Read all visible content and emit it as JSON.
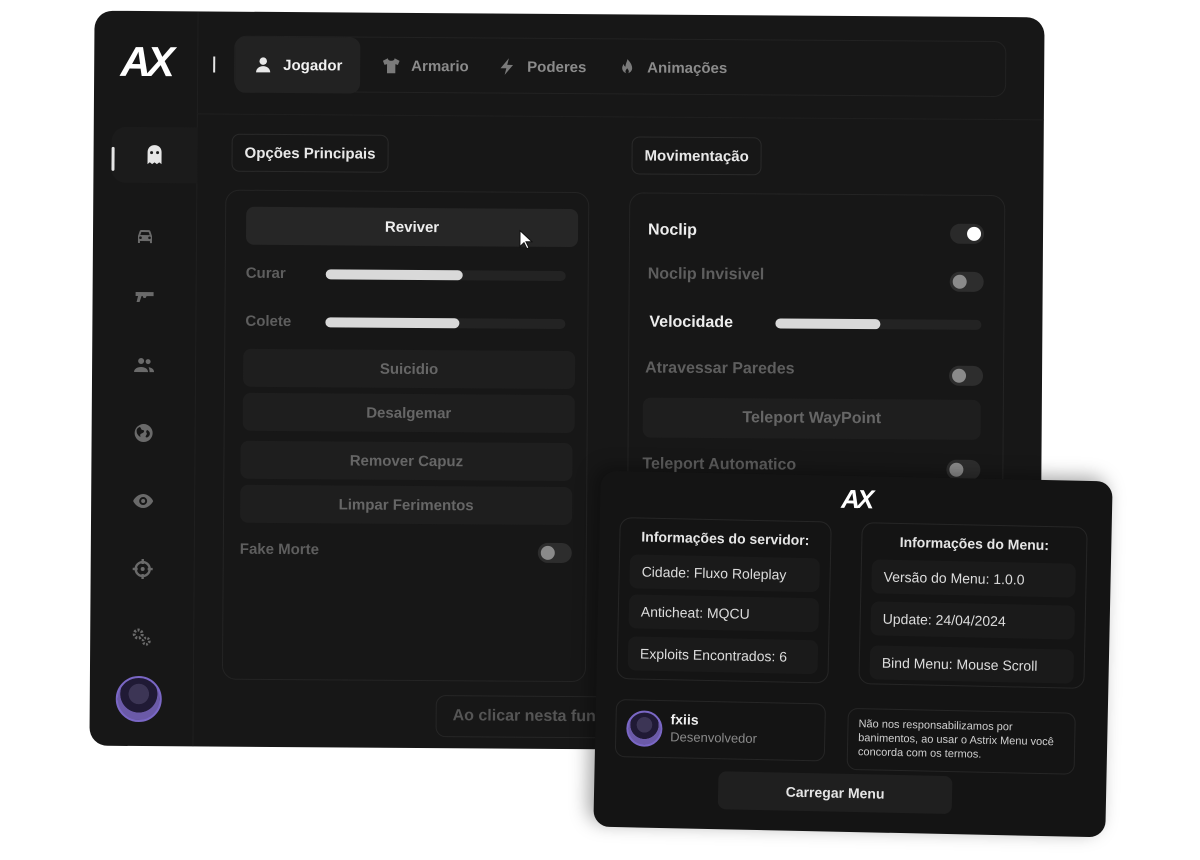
{
  "app": {
    "logo": "AX"
  },
  "tabs": [
    {
      "label": "Jogador",
      "icon": "user-icon",
      "active": true
    },
    {
      "label": "Armario",
      "icon": "shirt-icon"
    },
    {
      "label": "Poderes",
      "icon": "lightning-icon"
    },
    {
      "label": "Animações",
      "icon": "fire-icon"
    }
  ],
  "sidebar": {
    "items": [
      {
        "icon": "ghost-icon",
        "active": true
      },
      {
        "icon": "car-icon"
      },
      {
        "icon": "gun-icon"
      },
      {
        "icon": "users-icon"
      },
      {
        "icon": "globe-icon"
      },
      {
        "icon": "eye-icon"
      },
      {
        "icon": "crosshair-icon"
      },
      {
        "icon": "gears-icon"
      }
    ]
  },
  "main_options": {
    "title": "Opções Principais",
    "revive_label": "Reviver",
    "curar_label": "Curar",
    "curar_value": 0.57,
    "colete_label": "Colete",
    "colete_value": 0.56,
    "suicidio_label": "Suicidio",
    "desalgemar_label": "Desalgemar",
    "remover_capuz_label": "Remover Capuz",
    "limpar_label": "Limpar Ferimentos",
    "fake_morte_label": "Fake Morte",
    "fake_morte_on": false
  },
  "movement": {
    "title": "Movimentação",
    "noclip_label": "Noclip",
    "noclip_on": true,
    "noclip_invisivel_label": "Noclip Invisivel",
    "noclip_invisivel_on": false,
    "velocidade_label": "Velocidade",
    "velocidade_value": 0.51,
    "atravessar_label": "Atravessar Paredes",
    "atravessar_on": false,
    "teleport_waypoint_label": "Teleport WayPoint",
    "teleport_auto_label": "Teleport Automatico",
    "teleport_auto_on": false
  },
  "hint": "Ao clicar nesta fun",
  "info_card": {
    "logo": "AX",
    "server": {
      "title": "Informações do servidor:",
      "rows": [
        "Cidade: Fluxo Roleplay",
        "Anticheat: MQCU",
        "Exploits Encontrados: 6"
      ]
    },
    "menu": {
      "title": "Informações do Menu:",
      "rows": [
        "Versão do Menu: 1.0.0",
        "Update: 24/04/2024",
        "Bind Menu: Mouse Scroll"
      ]
    },
    "developer": {
      "name": "fxiis",
      "role": "Desenvolvedor"
    },
    "disclaimer": "Não nos responsabilizamos por banimentos, ao usar o Astrix Menu você concorda com os termos.",
    "load_label": "Carregar Menu"
  }
}
